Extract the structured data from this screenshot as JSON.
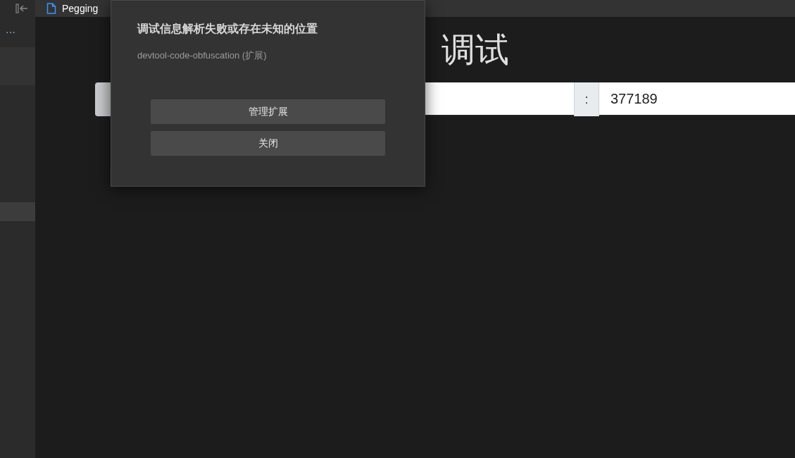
{
  "tab": {
    "label": "Pegging"
  },
  "sidebar": {
    "more": "···",
    "items": [
      {
        "selected": true
      },
      {
        "selected": false
      }
    ]
  },
  "page": {
    "heading_end": "调试",
    "separator": ":",
    "value": "377189"
  },
  "dialog": {
    "title": "调试信息解析失败或存在未知的位置",
    "source": "devtool-code-obfuscation (扩展)",
    "buttons": [
      "管理扩展",
      "关闭"
    ]
  }
}
